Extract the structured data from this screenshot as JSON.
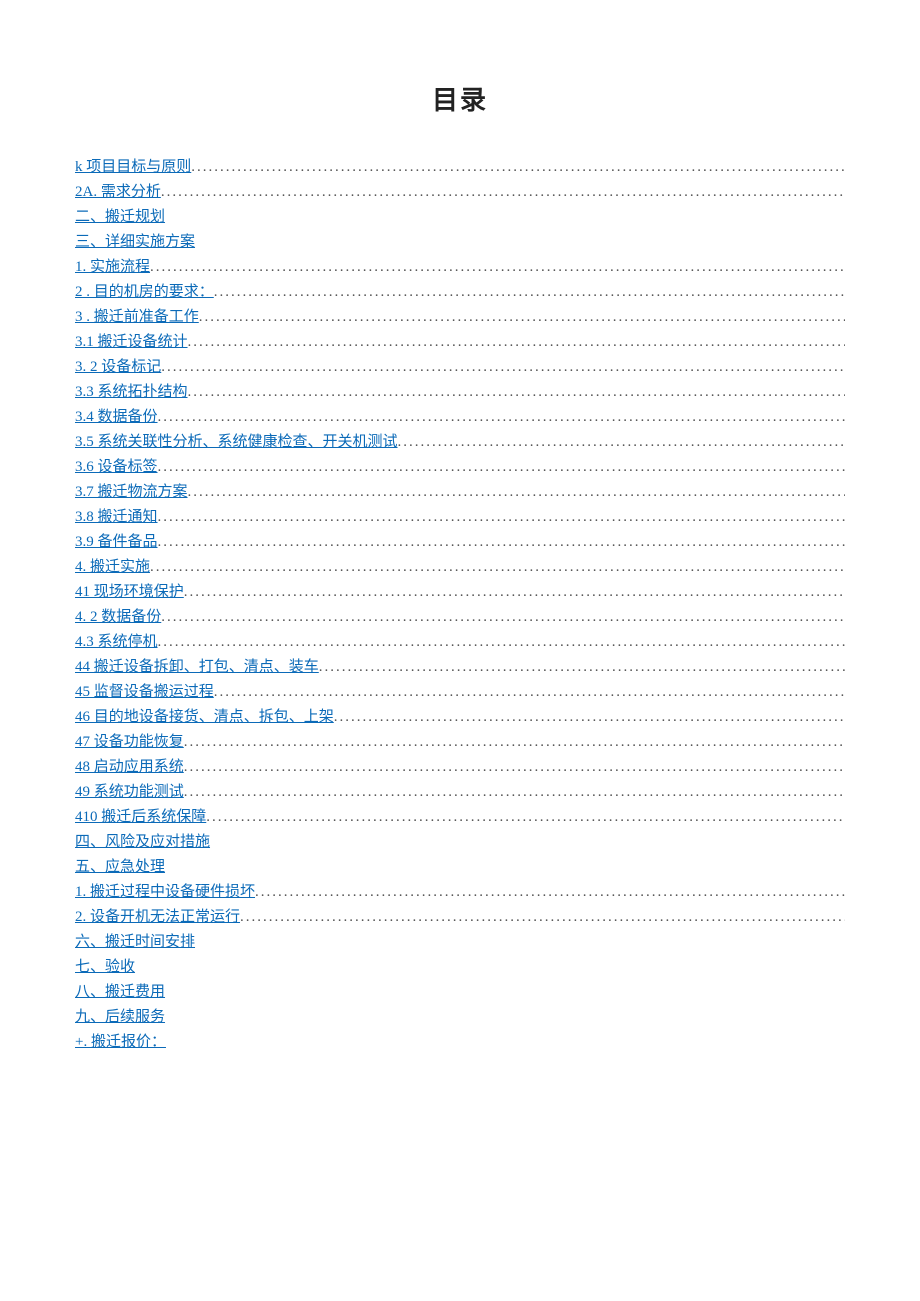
{
  "title": "目录",
  "toc": [
    {
      "label": "k 项目目标与原则",
      "dots": true
    },
    {
      "label": "2A.  需求分析",
      "dots": true
    },
    {
      "label": "二、搬迁规划",
      "dots": false
    },
    {
      "label": "三、详细实施方案",
      "dots": false
    },
    {
      "label": "1. 实施流程",
      "dots": true
    },
    {
      "label": "2  . 目的机房的要求：",
      "dots": true
    },
    {
      "label": "3  . 搬迁前准备工作",
      "dots": true
    },
    {
      "label": "3.1  搬迁设备统计",
      "dots": true
    },
    {
      "label": "3.  2 设备标记",
      "dots": true
    },
    {
      "label": "3.3 系统拓扑结构",
      "dots": true
    },
    {
      "label": "3.4 数据备份",
      "dots": true
    },
    {
      "label": "3.5 系统关联性分析、系统健康检查、开关机测试",
      "dots": true
    },
    {
      "label": "3.6 设备标签",
      "dots": true
    },
    {
      "label": "3.7 搬迁物流方案",
      "dots": true
    },
    {
      "label": "3.8 搬迁通知",
      "dots": true
    },
    {
      "label": "3.9 备件备品",
      "dots": true
    },
    {
      "label": "4. 搬迁实施",
      "dots": true
    },
    {
      "label": "41 现场环境保护",
      "dots": true
    },
    {
      "label": "4.  2 数据备份",
      "dots": true
    },
    {
      "label": "4.3 系统停机",
      "dots": true
    },
    {
      "label": "44 搬迁设备拆卸、打包、清点、装车",
      "dots": true
    },
    {
      "label": "45 监督设备搬运过程",
      "dots": true
    },
    {
      "label": "46 目的地设备接货、清点、拆包、上架",
      "dots": true
    },
    {
      "label": "47 设备功能恢复",
      "dots": true
    },
    {
      "label": "48 启动应用系统",
      "dots": true
    },
    {
      "label": "49 系统功能测试",
      "dots": true
    },
    {
      "label": "410 搬迁后系统保障",
      "dots": true
    },
    {
      "label": "四、风险及应对措施",
      "dots": false
    },
    {
      "label": "五、应急处理",
      "dots": false
    },
    {
      "label": "1. 搬迁过程中设备硬件损坏",
      "dots": true
    },
    {
      "label": "2. 设备开机无法正常运行",
      "dots": true
    },
    {
      "label": "六、搬迁时间安排",
      "dots": false
    },
    {
      "label": "七、验收",
      "dots": false
    },
    {
      "label": "八、搬迁费用",
      "dots": false
    },
    {
      "label": "九、后续服务",
      "dots": false
    },
    {
      "label": "+. 搬迁报价：",
      "dots": false
    }
  ]
}
